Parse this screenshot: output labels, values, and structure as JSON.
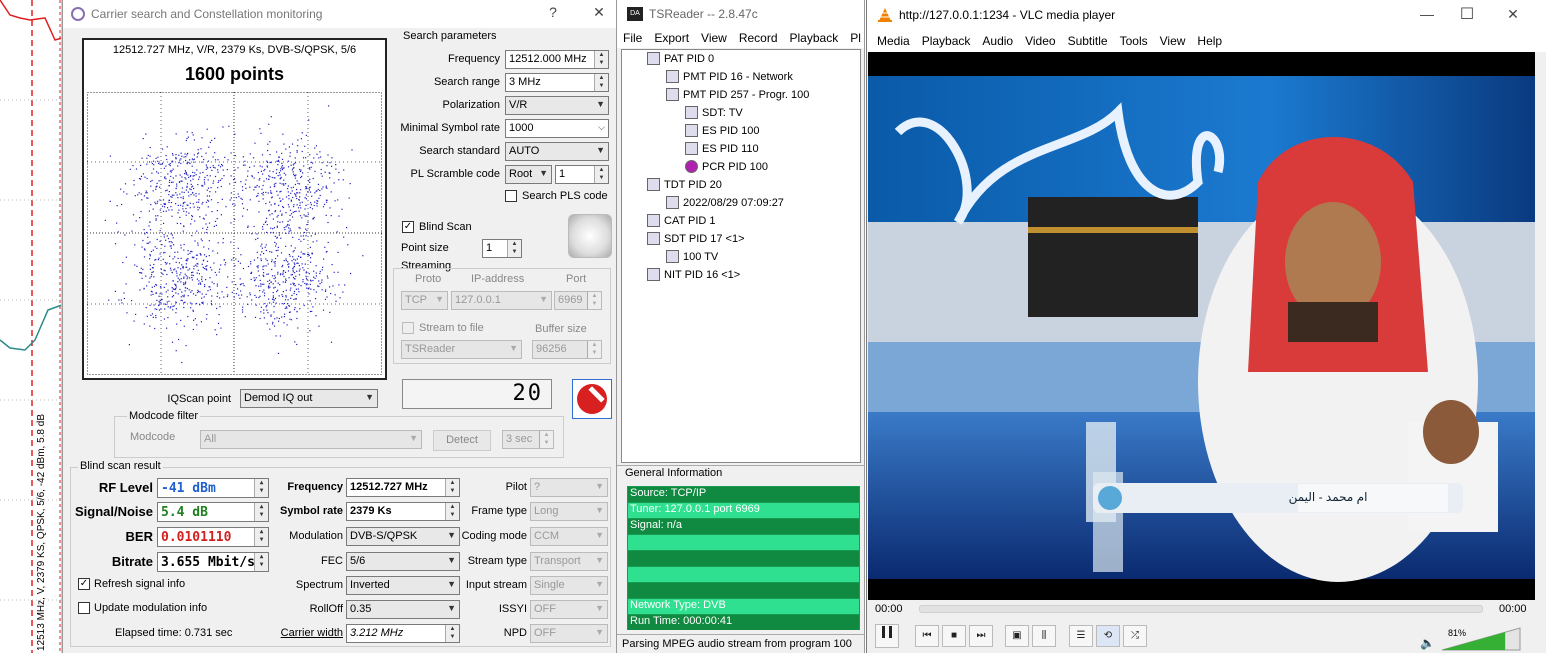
{
  "strip": {
    "vertical_text": "12513 MHz, V, 2379 KS, QPSK, 5/6, -42 dBm, 5.8 dB"
  },
  "carrier": {
    "title": "Carrier search and Constellation monitoring",
    "help": "?",
    "close": "✕",
    "plot_header": "12512.727 MHz, V/R, 2379 Ks, DVB-S/QPSK, 5/6",
    "points_label": "1600 points",
    "search_params_title": "Search parameters",
    "frequency_label": "Frequency",
    "frequency_value": "12512.000 MHz",
    "range_label": "Search range",
    "range_value": "3 MHz",
    "polarization_label": "Polarization",
    "polarization_value": "V/R",
    "minsr_label": "Minimal Symbol rate",
    "minsr_value": "1000",
    "standard_label": "Search standard",
    "standard_value": "AUTO",
    "pl_label": "PL Scramble code",
    "pl_root": "Root",
    "pl_value": "1",
    "search_pls_label": "Search PLS code",
    "blind_scan_label": "Blind Scan",
    "point_size_label": "Point size",
    "point_size_value": "1",
    "streaming_title": "Streaming",
    "proto_label": "Proto",
    "ip_label": "IP-address",
    "port_label": "Port",
    "proto_value": "TCP",
    "ip_value": "127.0.0.1",
    "port_value": "6969",
    "stream_file_label": "Stream to file",
    "buffer_label": "Buffer size",
    "tsreader_value": "TSReader",
    "buffer_value": "96256",
    "iqscan_label": "IQScan point",
    "iqscan_value": "Demod IQ out",
    "lcd_value": "20",
    "modcode_filter_title": "Modcode filter",
    "modcode_label": "Modcode",
    "modcode_value": "All",
    "detect_label": "Detect",
    "sec_value": "3 sec",
    "blind_result_title": "Blind scan result",
    "rf_label": "RF Level",
    "rf_value": "-41 dBm",
    "sn_label": "Signal/Noise",
    "sn_value": "5.4 dB",
    "ber_label": "BER",
    "ber_value": "0.0101110",
    "bitrate_label": "Bitrate",
    "bitrate_value": "3.655 Mbit/s",
    "refresh_label": "Refresh signal info",
    "update_label": "Update modulation info",
    "elapsed_label": "Elapsed time: 0.731 sec",
    "freq2_label": "Frequency",
    "freq2_value": "12512.727 MHz",
    "sr_label": "Symbol rate",
    "sr_value": "2379 Ks",
    "mod_label": "Modulation",
    "mod_value": "DVB-S/QPSK",
    "fec_label": "FEC",
    "fec_value": "5/6",
    "spectrum_label": "Spectrum",
    "spectrum_value": "Inverted",
    "rolloff_label": "RollOff",
    "rolloff_value": "0.35",
    "cw_label": "Carrier width",
    "cw_value": "3.212 MHz",
    "pilot_label": "Pilot",
    "pilot_value": "?",
    "frame_label": "Frame type",
    "frame_value": "Long",
    "coding_label": "Coding mode",
    "coding_value": "CCM",
    "stype_label": "Stream type",
    "stype_value": "Transport",
    "input_label": "Input stream",
    "input_value": "Single",
    "issyi_label": "ISSYI",
    "issyi_value": "OFF",
    "npd_label": "NPD",
    "npd_value": "OFF"
  },
  "tsreader": {
    "title": "TSReader -- 2.8.47c",
    "menu": [
      "File",
      "Export",
      "View",
      "Record",
      "Playback",
      "Pl"
    ],
    "tree": [
      "PAT PID 0",
      "PMT PID 16 - Network",
      "PMT PID 257 - Progr. 100",
      "SDT: TV",
      "ES PID 100",
      "ES PID 110",
      "PCR PID 100",
      "TDT PID 20",
      "2022/08/29 07:09:27",
      "CAT PID 1",
      "SDT PID 17 <1>",
      "100 TV",
      "NIT PID 16 <1>"
    ],
    "general_title": "General Information",
    "info": [
      "Source: TCP/IP",
      "Tuner: 127.0.0.1 port 6969",
      "Signal: n/a",
      "",
      "",
      "",
      "",
      "Network Type: DVB",
      "Run Time: 000:00:41"
    ],
    "status": "Parsing MPEG audio stream from program 100"
  },
  "vlc": {
    "title": "http://127.0.0.1:1234 - VLC media player",
    "menu": [
      "Media",
      "Playback",
      "Audio",
      "Video",
      "Subtitle",
      "Tools",
      "View",
      "Help"
    ],
    "time_left": "00:00",
    "time_right": "00:00",
    "volume": "81%",
    "volume_level": 0.81,
    "caption_text": "ام محمد - اليمن",
    "accent": "#35b035"
  }
}
